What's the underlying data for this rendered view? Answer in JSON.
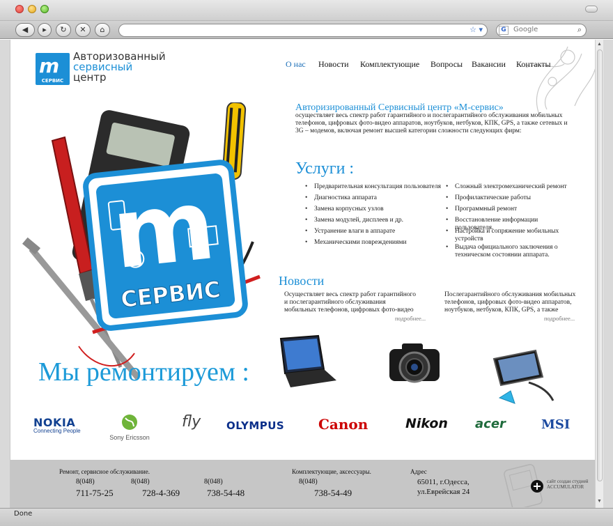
{
  "browser": {
    "nav": {
      "back": "◀",
      "forward": "▸",
      "reload": "↻",
      "stop": "✕",
      "home": "⌂"
    },
    "url": "",
    "search_badge": "G",
    "search_placeholder": "Google",
    "status": "Done"
  },
  "logo": {
    "mark": "m",
    "caption": "СЕРВИС",
    "line1": "Авторизованный",
    "line2": "сервисный",
    "line3": "центр"
  },
  "nav": [
    {
      "label": "О нас",
      "active": true
    },
    {
      "label": "Новости"
    },
    {
      "label": "Комплектующие"
    },
    {
      "label": "Вопросы"
    },
    {
      "label": "Вакансии"
    },
    {
      "label": "Контакты"
    }
  ],
  "hero": {
    "sign_text": "СЕРВИС",
    "sign_mark": "m"
  },
  "intro": {
    "title": "Авторизированный Сервисный центр  «М-сервис»",
    "body": "осуществляет весь спектр работ  гарантийного и послегарантийного обслуживания  мобильных телефонов, цифровых фото-видео аппаратов, ноутбуков, нетбуков, КПК, GPS, а также сетевых и 3G – модемов, включая ремонт высшей  категории сложности следующих фирм:"
  },
  "services": {
    "title": "Услуги :",
    "left": [
      "Предварительная консультация пользователя",
      "Диагностика аппарата",
      "Замена корпусных узлов",
      "Замена модулей, дисплеев и др.",
      "Устранение влаги в аппарате",
      "Механическими повреждениями"
    ],
    "right": [
      "Сложный электромеханический ремонт",
      "Профилактические работы",
      "Программный ремонт",
      "Восстановление  информации пользователя.",
      "Настройка и сопряжение мобильных устройств",
      "Выдача официального заключения о техническом состоянии аппарата."
    ]
  },
  "news": {
    "title": "Новости",
    "items": [
      {
        "text": "Осуществляет весь спектр работ  гарантийного и послегарантийного обслуживания  мобильных телефонов, цифровых фото-видео",
        "more": "подробнее..."
      },
      {
        "text": "Послегарантийного обслуживания  мобильных телефонов, цифровых фото-видео аппаратов, ноутбуков, нетбуков, КПК, GPS, а также",
        "more": "подробнее..."
      }
    ]
  },
  "repair_title": "Мы ремонтируем :",
  "devices": [
    "laptop",
    "dslr-camera",
    "smartphone"
  ],
  "brands": [
    {
      "name": "NOKIA",
      "sub": "Connecting People",
      "color": "#124191"
    },
    {
      "name": "Sony Ericsson",
      "color": "#555555"
    },
    {
      "name": "fly",
      "color": "#444444"
    },
    {
      "name": "OLYMPUS",
      "color": "#0b2f8a"
    },
    {
      "name": "Canon",
      "color": "#cc0000"
    },
    {
      "name": "Nikon",
      "color": "#111111"
    },
    {
      "name": "acer",
      "color": "#1f6b3c"
    },
    {
      "name": "MSI",
      "color": "#1c4aa0"
    }
  ],
  "footer": {
    "repair_title": "Ремонт, сервисное обслуживание.",
    "phones": [
      {
        "code": "8(048)",
        "number": "711-75-25"
      },
      {
        "code": "8(048)",
        "number": "728-4-369"
      },
      {
        "code": "8(048)",
        "number": "738-54-48"
      }
    ],
    "parts_title": "Комплектующие, аксессуары.",
    "parts_phone": {
      "code": "8(048)",
      "number": "738-54-49"
    },
    "address_title": "Адрес",
    "address_line1": "65011, г.Одесса,",
    "address_line2": "ул.Еврейская 24",
    "studio_line1": "сайт создан студией",
    "studio_line2": "ACCUMULATOR"
  },
  "colors": {
    "accent": "#1c8fd6",
    "footer_bg": "#c6c6c6",
    "link_active": "#1c6fb8"
  }
}
